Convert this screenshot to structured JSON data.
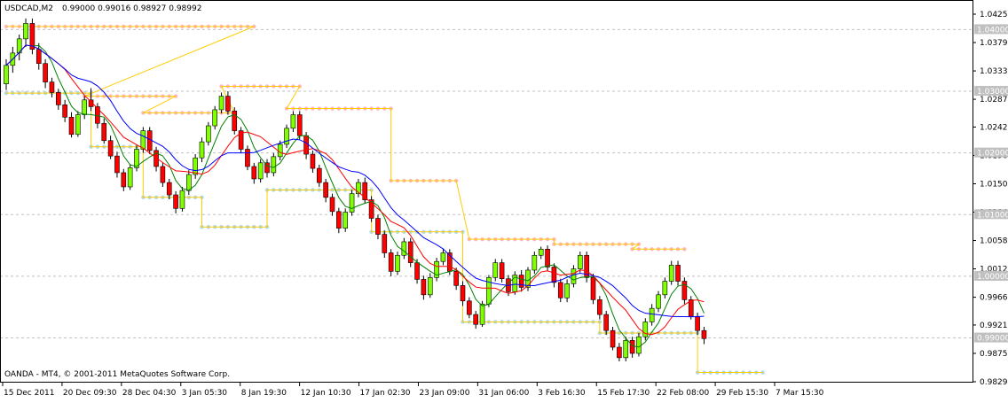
{
  "header": {
    "symbol_timeframe": "USDCAD,M2",
    "ohlc": "0.99000 0.99016 0.98927 0.98992"
  },
  "footer": {
    "copyright": "OANDA - MT4, © 2001-2011 MetaQuotes Software Corp."
  },
  "colors": {
    "background": "#ffffff",
    "grid": "#c0c0c0",
    "bull_candle": "#7fff00",
    "bear_candle": "#ff0000",
    "wick": "#000000",
    "ma_fast": "#008000",
    "ma_mid": "#ff0000",
    "ma_slow": "#0000ff",
    "channel": "#ffcc00",
    "resistance_dots": "#ffb6c1",
    "support_dots": "#add8e6",
    "level_box": "#c0c0c0"
  },
  "chart_data": {
    "type": "candlestick",
    "symbol": "USDCAD",
    "timeframe": "M2",
    "ylim": [
      0.9829,
      1.0425
    ],
    "grid": true,
    "y_ticks": [
      "1.04250",
      "1.03790",
      "1.03330",
      "1.02870",
      "1.02420",
      "1.01960",
      "1.01500",
      "1.01040",
      "1.00580",
      "1.00120",
      "0.99660",
      "0.99210",
      "0.98750",
      "0.98290"
    ],
    "level_lines": [
      {
        "label": "1.04000",
        "value": 1.04
      },
      {
        "label": "1.03000",
        "value": 1.03
      },
      {
        "label": "1.02000",
        "value": 1.02
      },
      {
        "label": "1.01000",
        "value": 1.01
      },
      {
        "label": "1.00000",
        "value": 1.0
      },
      {
        "label": "0.99000",
        "value": 0.99
      }
    ],
    "x_ticks": [
      "15 Dec 2011",
      "20 Dec 09:30",
      "28 Dec 04:30",
      "3 Jan 05:30",
      "8 Jan 19:30",
      "12 Jan 10:30",
      "17 Jan 02:30",
      "23 Jan 09:00",
      "31 Jan 06:00",
      "3 Feb 16:30",
      "15 Feb 17:30",
      "22 Feb 08:00",
      "29 Feb 15:30",
      "7 Mar 15:30"
    ],
    "candles": [
      [
        1.0312,
        1.0352,
        1.0302,
        1.0342
      ],
      [
        1.0342,
        1.0372,
        1.033,
        1.0362
      ],
      [
        1.0362,
        1.0392,
        1.035,
        1.0385
      ],
      [
        1.0385,
        1.0418,
        1.0372,
        1.041
      ],
      [
        1.041,
        1.0418,
        1.036,
        1.0368
      ],
      [
        1.0368,
        1.0378,
        1.0335,
        1.0345
      ],
      [
        1.0345,
        1.0352,
        1.0305,
        1.0315
      ],
      [
        1.0315,
        1.0322,
        1.029,
        1.0298
      ],
      [
        1.0298,
        1.0304,
        1.027,
        1.0278
      ],
      [
        1.0278,
        1.0286,
        1.025,
        1.0258
      ],
      [
        1.0258,
        1.0266,
        1.0225,
        1.023
      ],
      [
        1.023,
        1.0268,
        1.0226,
        1.0262
      ],
      [
        1.0262,
        1.0292,
        1.0255,
        1.0286
      ],
      [
        1.0286,
        1.0305,
        1.0268,
        1.0275
      ],
      [
        1.0275,
        1.0281,
        1.024,
        1.0248
      ],
      [
        1.0248,
        1.0256,
        1.0215,
        1.022
      ],
      [
        1.022,
        1.0228,
        1.019,
        1.0195
      ],
      [
        1.0195,
        1.0202,
        1.016,
        1.0168
      ],
      [
        1.0168,
        1.0174,
        1.0138,
        1.0145
      ],
      [
        1.0145,
        1.0182,
        1.014,
        1.0176
      ],
      [
        1.0176,
        1.0212,
        1.017,
        1.0206
      ],
      [
        1.0206,
        1.0242,
        1.02,
        1.0236
      ],
      [
        1.0236,
        1.0242,
        1.0198,
        1.0204
      ],
      [
        1.0204,
        1.021,
        1.017,
        1.0178
      ],
      [
        1.0178,
        1.0184,
        1.0145,
        1.0152
      ],
      [
        1.0152,
        1.0158,
        1.0125,
        1.0132
      ],
      [
        1.0132,
        1.0138,
        1.0102,
        1.011
      ],
      [
        1.011,
        1.0145,
        1.0105,
        1.0139
      ],
      [
        1.0139,
        1.0172,
        1.0132,
        1.0165
      ],
      [
        1.0165,
        1.0198,
        1.0158,
        1.0192
      ],
      [
        1.0192,
        1.0225,
        1.0185,
        1.0218
      ],
      [
        1.0218,
        1.025,
        1.0212,
        1.0244
      ],
      [
        1.0244,
        1.0276,
        1.0238,
        1.027
      ],
      [
        1.027,
        1.0298,
        1.0264,
        1.0292
      ],
      [
        1.0292,
        1.03,
        1.0262,
        1.0268
      ],
      [
        1.0268,
        1.0274,
        1.023,
        1.0236
      ],
      [
        1.0236,
        1.0242,
        1.02,
        1.0206
      ],
      [
        1.0206,
        1.0212,
        1.0172,
        1.0178
      ],
      [
        1.0178,
        1.0184,
        1.015,
        1.0158
      ],
      [
        1.0158,
        1.019,
        1.0152,
        1.0184
      ],
      [
        1.0184,
        1.019,
        1.016,
        1.0168
      ],
      [
        1.0168,
        1.02,
        1.0162,
        1.0194
      ],
      [
        1.0194,
        1.022,
        1.0188,
        1.0214
      ],
      [
        1.0214,
        1.0246,
        1.0208,
        1.024
      ],
      [
        1.024,
        1.0268,
        1.0234,
        1.0262
      ],
      [
        1.0262,
        1.0268,
        1.0222,
        1.0228
      ],
      [
        1.0228,
        1.0234,
        1.019,
        1.0198
      ],
      [
        1.0198,
        1.0204,
        1.0168,
        1.0175
      ],
      [
        1.0175,
        1.0181,
        1.0145,
        1.0152
      ],
      [
        1.0152,
        1.0158,
        1.012,
        1.0128
      ],
      [
        1.0128,
        1.0134,
        1.0098,
        1.0105
      ],
      [
        1.0105,
        1.0111,
        1.007,
        1.0078
      ],
      [
        1.0078,
        1.011,
        1.0072,
        1.0104
      ],
      [
        1.0104,
        1.014,
        1.0098,
        1.0134
      ],
      [
        1.0134,
        1.0158,
        1.0128,
        1.0152
      ],
      [
        1.0152,
        1.016,
        1.0118,
        1.0124
      ],
      [
        1.0124,
        1.013,
        1.0088,
        1.0094
      ],
      [
        1.0094,
        1.01,
        1.006,
        1.0068
      ],
      [
        1.0068,
        1.0074,
        1.003,
        1.0038
      ],
      [
        1.0038,
        1.0044,
        1.0,
        1.0008
      ],
      [
        1.0008,
        1.004,
        1.0002,
        1.0034
      ],
      [
        1.0034,
        1.0062,
        1.0028,
        1.0056
      ],
      [
        1.0056,
        1.0062,
        1.0015,
        1.0022
      ],
      [
        1.0022,
        1.0028,
        0.9988,
        0.9995
      ],
      [
        0.9995,
        1.0001,
        0.9962,
        0.997
      ],
      [
        0.997,
        1.0005,
        0.9965,
        0.9998
      ],
      [
        0.9998,
        1.003,
        0.9992,
        1.0024
      ],
      [
        1.0024,
        1.0045,
        1.0018,
        1.0038
      ],
      [
        1.0038,
        1.0044,
        1.0002,
        1.0008
      ],
      [
        1.0008,
        1.0014,
        0.9978,
        0.9985
      ],
      [
        0.9985,
        0.9992,
        0.9952,
        0.996
      ],
      [
        0.996,
        0.9966,
        0.9932,
        0.9938
      ],
      [
        0.9938,
        0.9944,
        0.9915,
        0.9922
      ],
      [
        0.9922,
        0.996,
        0.9918,
        0.9955
      ],
      [
        0.9955,
        1.0002,
        0.995,
        0.9998
      ],
      [
        0.9998,
        1.0028,
        0.9992,
        1.0022
      ],
      [
        1.0022,
        1.0028,
        0.999,
        0.9996
      ],
      [
        0.9996,
        1.0002,
        0.9968,
        0.9975
      ],
      [
        0.9975,
        1.0008,
        0.997,
        1.0002
      ],
      [
        1.0002,
        1.001,
        0.9975,
        0.9982
      ],
      [
        0.9982,
        1.0015,
        0.9976,
        1.001
      ],
      [
        1.001,
        1.004,
        1.0004,
        1.0034
      ],
      [
        1.0034,
        1.0048,
        1.0028,
        1.0044
      ],
      [
        1.0044,
        1.005,
        1.0008,
        1.0015
      ],
      [
        1.0015,
        1.0021,
        0.9982,
        0.999
      ],
      [
        0.999,
        0.9996,
        0.9958,
        0.9965
      ],
      [
        0.9965,
        0.9995,
        0.9958,
        0.9988
      ],
      [
        0.9988,
        1.0018,
        0.9982,
        1.0012
      ],
      [
        1.0012,
        1.004,
        1.0006,
        1.0034
      ],
      [
        1.0034,
        1.004,
        0.999,
        0.9998
      ],
      [
        0.9998,
        1.0004,
        0.9955,
        0.9962
      ],
      [
        0.9962,
        0.9968,
        0.993,
        0.9938
      ],
      [
        0.9938,
        0.9944,
        0.9905,
        0.9912
      ],
      [
        0.9912,
        0.9918,
        0.988,
        0.9885
      ],
      [
        0.9885,
        0.9892,
        0.9862,
        0.9868
      ],
      [
        0.9868,
        0.9902,
        0.9862,
        0.9896
      ],
      [
        0.9896,
        0.9902,
        0.9868,
        0.9875
      ],
      [
        0.9875,
        0.9908,
        0.987,
        0.9902
      ],
      [
        0.9902,
        0.9932,
        0.9896,
        0.9926
      ],
      [
        0.9926,
        0.9955,
        0.992,
        0.9948
      ],
      [
        0.9948,
        0.9976,
        0.9942,
        0.997
      ],
      [
        0.997,
        0.9998,
        0.9964,
        0.9992
      ],
      [
        0.9992,
        1.0025,
        0.9986,
        1.0018
      ],
      [
        1.0018,
        1.0025,
        0.9985,
        0.9992
      ],
      [
        0.9992,
        0.9998,
        0.9955,
        0.9962
      ],
      [
        0.9962,
        0.9968,
        0.993,
        0.9935
      ],
      [
        0.9935,
        0.9941,
        0.9905,
        0.9912
      ],
      [
        0.9912,
        0.9918,
        0.989,
        0.9899
      ]
    ],
    "resistance_dots": [
      [
        0,
        38,
        1.0405
      ],
      [
        12,
        26,
        1.0292
      ],
      [
        21,
        35,
        1.0265
      ],
      [
        33,
        45,
        1.0308
      ],
      [
        43,
        59,
        1.0272
      ],
      [
        59,
        69,
        1.0155
      ],
      [
        71,
        84,
        1.006
      ],
      [
        84,
        97,
        1.0052
      ],
      [
        96,
        104,
        1.0044
      ]
    ],
    "support_dots": [
      [
        0,
        13,
        1.0297
      ],
      [
        13,
        21,
        1.021
      ],
      [
        21,
        30,
        1.0128
      ],
      [
        30,
        40,
        1.008
      ],
      [
        40,
        56,
        1.014
      ],
      [
        56,
        70,
        1.0072
      ],
      [
        70,
        91,
        0.9926
      ],
      [
        91,
        106,
        0.9908
      ],
      [
        106,
        116,
        0.9844
      ]
    ]
  }
}
